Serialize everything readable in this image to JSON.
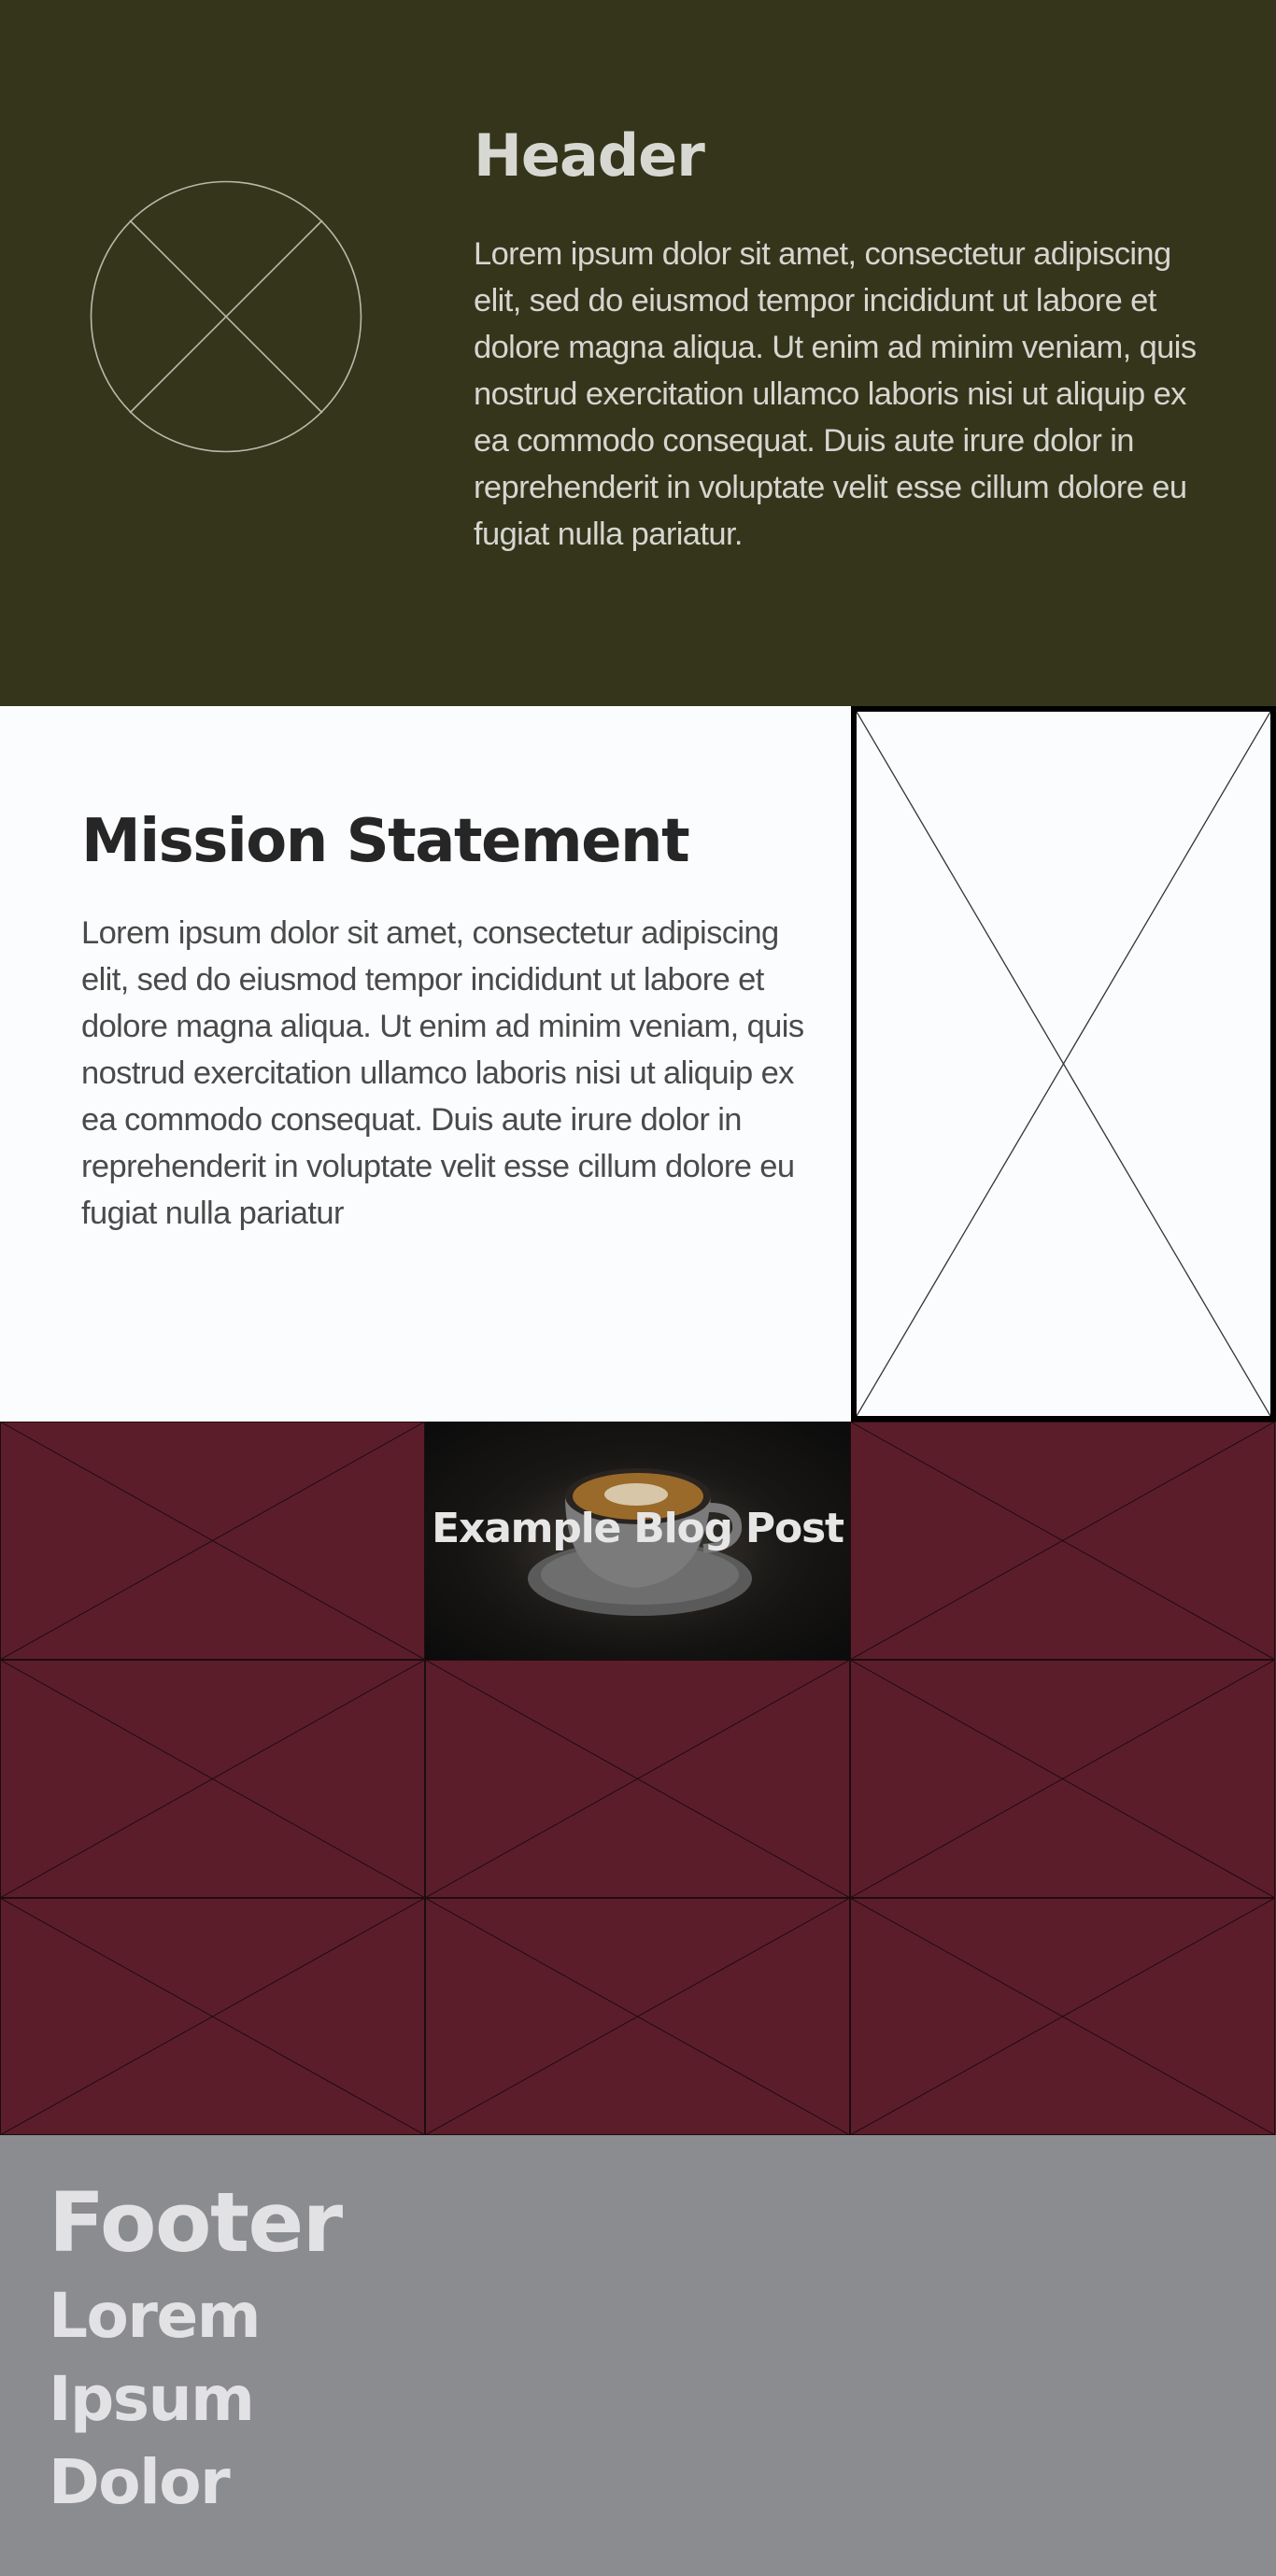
{
  "colors": {
    "header_bg": "#35351c",
    "mission_bg": "#fbfcfe",
    "gallery_bg": "#5c1d2a",
    "footer_bg": "#8b8c90"
  },
  "header": {
    "logo_icon": "image-placeholder-circle-icon",
    "title": "Header",
    "body": "Lorem ipsum dolor sit amet, consectetur adipiscing elit, sed do eiusmod tempor incididunt ut labore et dolore magna aliqua. Ut enim ad minim veniam, quis nostrud exercitation ullamco laboris nisi ut aliquip ex ea commodo consequat. Duis aute irure dolor in reprehenderit in voluptate velit esse cillum dolore eu fugiat nulla pariatur."
  },
  "mission": {
    "title": "Mission Statement",
    "body": "Lorem ipsum dolor sit amet, consectetur adipiscing elit, sed do eiusmod tempor incididunt ut labore et dolore magna aliqua. Ut enim ad minim veniam, quis nostrud exercitation ullamco laboris nisi ut aliquip ex ea commodo consequat. Duis aute irure dolor in reprehenderit in voluptate velit esse cillum dolore eu fugiat nulla pariatur",
    "image_icon": "image-placeholder-icon"
  },
  "gallery": {
    "blog_post_title": "Example Blog Post",
    "blog_post_image": "coffee-cup-photo"
  },
  "footer": {
    "title": "Footer",
    "lines": [
      "Lorem",
      "Ipsum",
      "Dolor"
    ]
  }
}
